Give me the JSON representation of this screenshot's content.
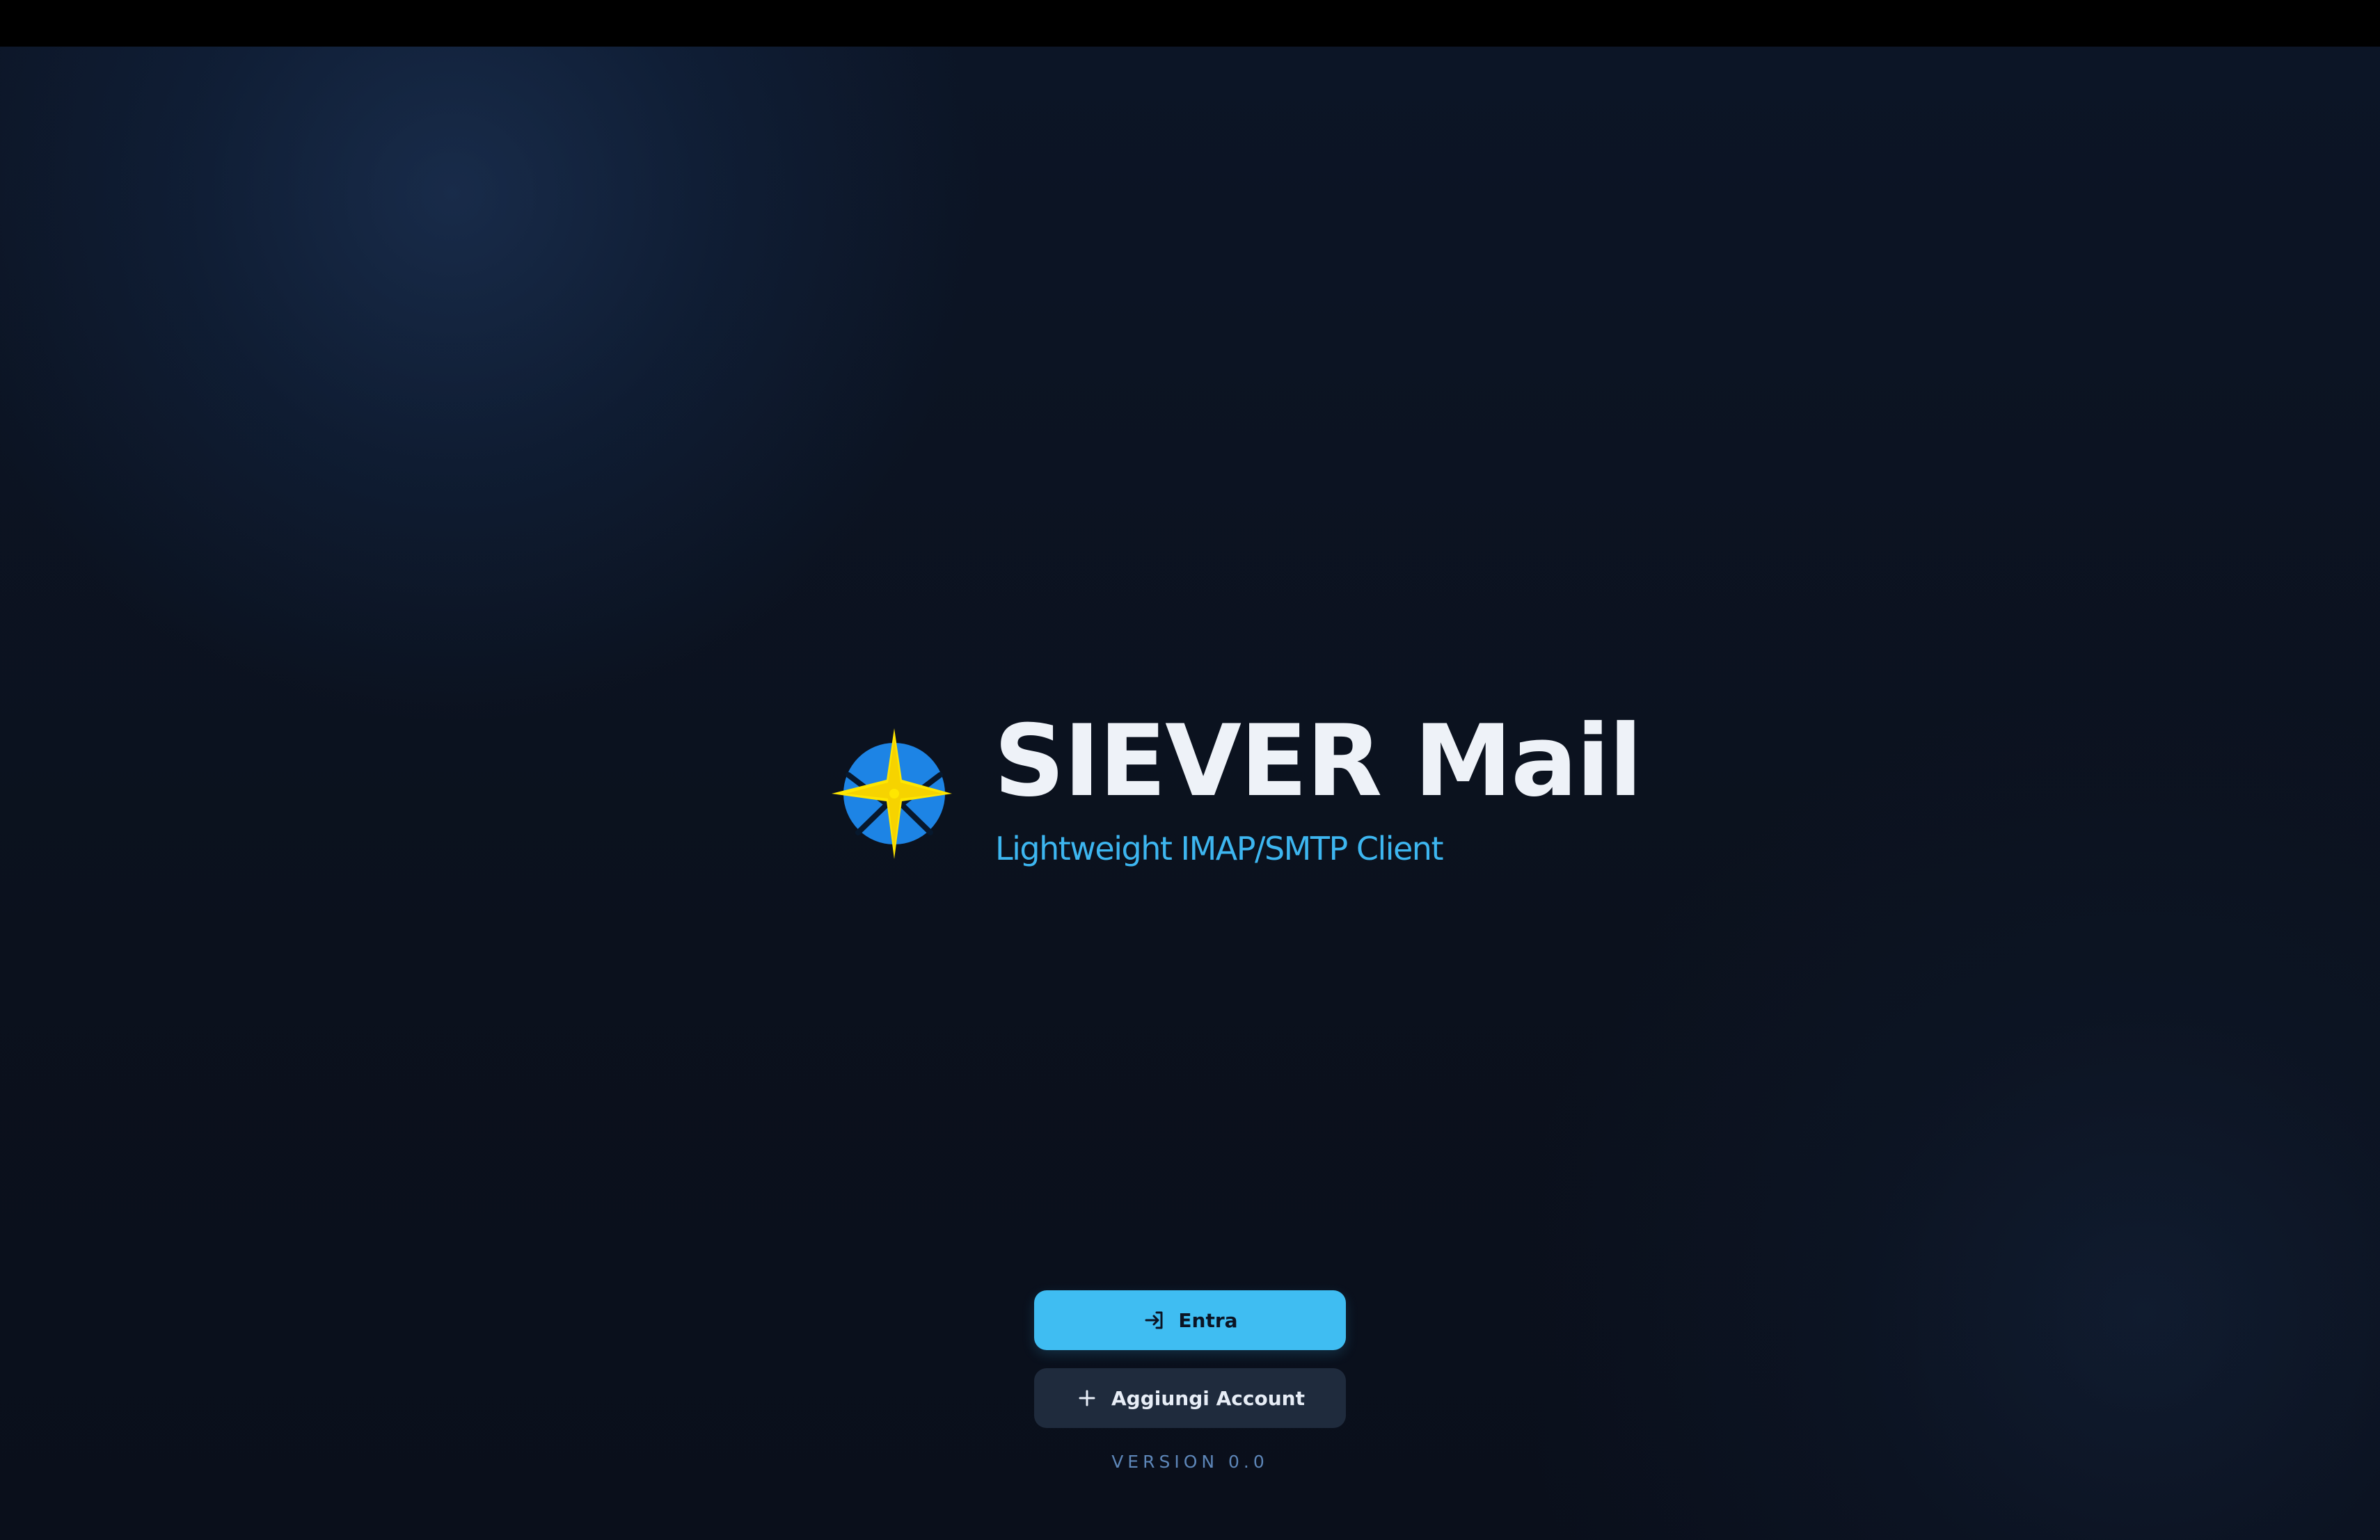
{
  "app": {
    "title": "SIEVER Mail",
    "subtitle": "Lightweight IMAP/SMTP Client",
    "logo_icon": "envelope-star-logo"
  },
  "actions": {
    "enter": {
      "label": "Entra",
      "icon": "login-arrow-icon"
    },
    "add_account": {
      "label": "Aggiungi Account",
      "icon": "plus-icon"
    }
  },
  "footer": {
    "version": "VERSION 0.0"
  },
  "colors": {
    "background": "#0b111d",
    "title": "#eef2f8",
    "accent": "#3db6f0",
    "primary_button": "#3fbdf2",
    "secondary_button": "#1f2b3d",
    "version_text": "#5d86b8"
  }
}
